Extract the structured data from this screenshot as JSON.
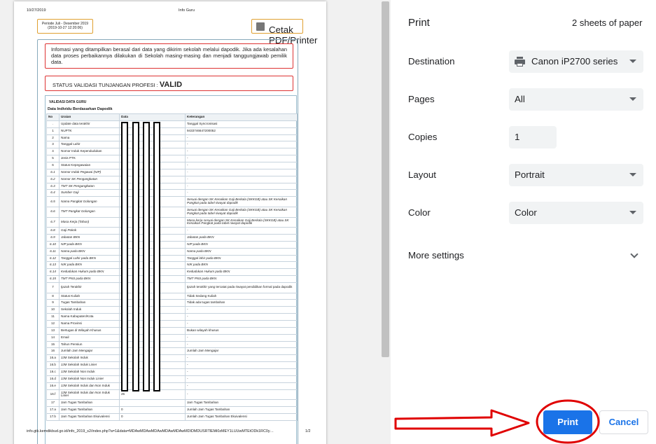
{
  "preview": {
    "header_date": "10/27/2019",
    "header_title": "Info Guru",
    "period_line1": "Periode Juli - Desember 2019",
    "period_line2": "(2019-10-27 12:20:06)",
    "print_pdf_label": "Cetak PDF/Printer",
    "info_text": "Infomasi yang ditampilkan berasal dari data yang dikirim sekolah melalui dapodik. Jika ada kesalahan data proses perbaikannya dilakukan di Sekolah masing-masing dan menjadi tanggungjawab pemilik data.",
    "status_label": "STATUS VALIDASI TUNJANGAN PROFESI :",
    "status_value": "VALID",
    "section_title": "VALIDASI DATA GURU",
    "section_subtitle": "Data Individu Berdasarkan Dapodik",
    "table_headers": [
      "No",
      "Uraian",
      "Data",
      "Keterangan"
    ],
    "footer_url": "info.gtk.kemdikbud.go.id/info_2019_s2/index.php?a=1&data=MDAwMDAwMDAwMDAwMDAwMDIDMDUSRTlEMi0zMEY1LUUwMTEtODk1RC0y…",
    "footer_page": "1/2"
  },
  "table_rows": [
    {
      "no": ".",
      "uraian": "Update data terakhir",
      "data": "",
      "ket": "Tanggal Syncronisasi"
    },
    {
      "no": "1",
      "uraian": "NUPTK",
      "data": "",
      "ket": "9433746647200052"
    },
    {
      "no": "2",
      "uraian": "Nama",
      "data": "",
      "ket": "-"
    },
    {
      "no": "3",
      "uraian": "Tanggal Lahir",
      "data": "",
      "ket": "-"
    },
    {
      "no": "4",
      "uraian": "Nomor Induk Kependudukan",
      "data": "",
      "ket": "-"
    },
    {
      "no": "5",
      "uraian": "Jenis PTK",
      "data": "",
      "ket": "-"
    },
    {
      "no": "6",
      "uraian": "Status Kepegawaian",
      "data": "",
      "ket": "-"
    },
    {
      "no": "6.1",
      "uraian": "Nomor Induk Pegawai (NIP)",
      "data": "",
      "ket": "-",
      "it": true
    },
    {
      "no": "6.2",
      "uraian": "Nomor SK Pengangkatan",
      "data": "",
      "ket": "-",
      "it": true
    },
    {
      "no": "6.3",
      "uraian": "TMT SK Pengangkatan",
      "data": "",
      "ket": "-",
      "it": true
    },
    {
      "no": "6.4",
      "uraian": "Sumber Gaji",
      "data": "",
      "ket": "-",
      "it": true
    },
    {
      "no": "6.5",
      "uraian": "Nama Pangkat Golongan",
      "data": "",
      "ket": "Sesuai dengan SK Kenaikan Gaji Berkala (SKKGB) atau SK Kenaikan Pangkat pada tabel riwayat dapodik",
      "it": true,
      "tall": true
    },
    {
      "no": "6.6",
      "uraian": "TMT Pangkat Golongan",
      "data": "",
      "ket": "Sesuai dengan SK Kenaikan Gaji Berkala (SKKGB) atau SK Kenaikan Pangkat pada tabel riwayat dapodik",
      "it": true,
      "tall": true
    },
    {
      "no": "6.7",
      "uraian": "Masa Kerja (Tahun)",
      "data": "",
      "ket": "Masa kerja sesuai dengan SK Kenaikan Gaji Berkala (SKKGB) atau SK Kenaikan Pangkat pada tabel riwayat dapodik",
      "it": true,
      "tall": true
    },
    {
      "no": "6.8",
      "uraian": "Gaji Pokok",
      "data": "",
      "ket": "-",
      "it": true
    },
    {
      "no": "6.9",
      "uraian": "Jabatan BKN",
      "data": "",
      "ket": "Jabatan pada BKN",
      "it": true
    },
    {
      "no": "6.10",
      "uraian": "NIP pada BKN",
      "data": "",
      "ket": "NIP pada BKN",
      "it": true
    },
    {
      "no": "6.11",
      "uraian": "Nama pada BKN",
      "data": "",
      "ket": "Nama pada BKN",
      "it": true
    },
    {
      "no": "6.12",
      "uraian": "Tanggal Lahir pada BKN",
      "data": "",
      "ket": "Tanggal lahir pada BKN",
      "it": true
    },
    {
      "no": "6.13",
      "uraian": "NIK pada BKN",
      "data": "",
      "ket": "NIK pada BKN",
      "it": true
    },
    {
      "no": "6.14",
      "uraian": "Kedudukan Hukum pada BKN",
      "data": "",
      "ket": "Kedudukan Hukum pada BKN",
      "it": true
    },
    {
      "no": "6.15",
      "uraian": "TMT PNS pada BKN",
      "data": "",
      "ket": "TMT PNS pada BKN",
      "it": true
    },
    {
      "no": "7",
      "uraian": "Ijazah Terakhir",
      "data": "",
      "ket": "Ijazah terakhir yang tercatat pada riwayat pendidikan formal pada dapodik",
      "tall": true
    },
    {
      "no": "8",
      "uraian": "Status Kuliah",
      "data": "",
      "ket": "Tidak Sedang Kuliah"
    },
    {
      "no": "9",
      "uraian": "Tugas Tambahan",
      "data": "",
      "ket": "Tidak ada tugas tambahan"
    },
    {
      "no": "10",
      "uraian": "Sekolah Induk",
      "data": "",
      "ket": "-"
    },
    {
      "no": "11",
      "uraian": "Nama Kabupaten/Kota",
      "data": "",
      "ket": "-"
    },
    {
      "no": "12",
      "uraian": "Nama Provinsi",
      "data": "",
      "ket": "-"
    },
    {
      "no": "13",
      "uraian": "Bertugas di Wilayah Khusus",
      "data": "",
      "ket": "Bukan wilayah khusus"
    },
    {
      "no": "14",
      "uraian": "Email",
      "data": "",
      "ket": "-"
    },
    {
      "no": "15",
      "uraian": "Tahun Pensiun",
      "data": "",
      "ket": "-"
    },
    {
      "no": "16",
      "uraian": "Jumlah Jam Mengajar",
      "data": "",
      "ket": "Jumlah Jam Mengajar"
    },
    {
      "no": "16.a",
      "uraian": "JJM Sekolah Induk",
      "data": "",
      "ket": "-"
    },
    {
      "no": "16.b",
      "uraian": "JJM Sekolah Induk Linier",
      "data": "",
      "ket": "-"
    },
    {
      "no": "16.c",
      "uraian": "JJM Sekolah Non Induk",
      "data": "",
      "ket": "-"
    },
    {
      "no": "16.d",
      "uraian": "JJM Sekolah Non Induk Linier",
      "data": "",
      "ket": "-"
    },
    {
      "no": "16.e",
      "uraian": "JJM Sekolah Induk dan Non Induk",
      "data": "25",
      "ket": "-"
    },
    {
      "no": "16.f",
      "uraian": "JJM Sekolah Induk dan Non Induk Linier",
      "data": "25",
      "ket": "-",
      "tall": true
    },
    {
      "no": "17",
      "uraian": "Jam Tugas Tambahan",
      "data": "",
      "ket": "Jam Tugas Tambahan"
    },
    {
      "no": "17.a",
      "uraian": "Jam Tugas Tambahan",
      "data": "0",
      "ket": "Jumlah Jam Tugas Tambahan"
    },
    {
      "no": "17.b",
      "uraian": "Jam Tugas Tambahan Ekuivalensi",
      "data": "0",
      "ket": "Jumlah Jam Tugas Tambahan Ekuivalensi"
    }
  ],
  "panel": {
    "title": "Print",
    "sheets": "2 sheets of paper",
    "destination_label": "Destination",
    "destination_value": "Canon iP2700 series",
    "pages_label": "Pages",
    "pages_value": "All",
    "copies_label": "Copies",
    "copies_value": "1",
    "layout_label": "Layout",
    "layout_value": "Portrait",
    "color_label": "Color",
    "color_value": "Color",
    "more_settings": "More settings",
    "print_button": "Print",
    "cancel_button": "Cancel",
    "accent_color": "#1a73e8"
  },
  "annotation": {
    "color": "#e00000",
    "shapes": [
      "arrow-right",
      "ellipse-around-print-button"
    ]
  }
}
